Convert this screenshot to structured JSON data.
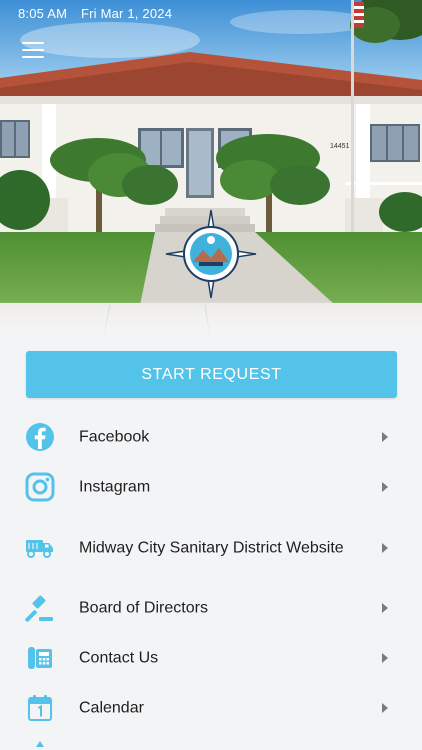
{
  "status_bar": {
    "time": "8:05 AM",
    "date": "Fri Mar 1, 2024"
  },
  "hero": {
    "house_number": "14451"
  },
  "start_request": {
    "label": "START REQUEST"
  },
  "menu": [
    {
      "label": "Facebook",
      "icon": "facebook-icon"
    },
    {
      "label": "Instagram",
      "icon": "instagram-icon"
    },
    {
      "label": "Midway City Sanitary District Website",
      "icon": "garbage-truck-icon"
    },
    {
      "label": "Board of Directors",
      "icon": "gavel-icon"
    },
    {
      "label": "Contact Us",
      "icon": "phone-icon"
    },
    {
      "label": "Calendar",
      "icon": "calendar-icon"
    }
  ],
  "colors": {
    "accent": "#54c3ea",
    "background": "#f3f4f6",
    "text": "#1f1f1f",
    "chevron": "#7a7a7a"
  }
}
